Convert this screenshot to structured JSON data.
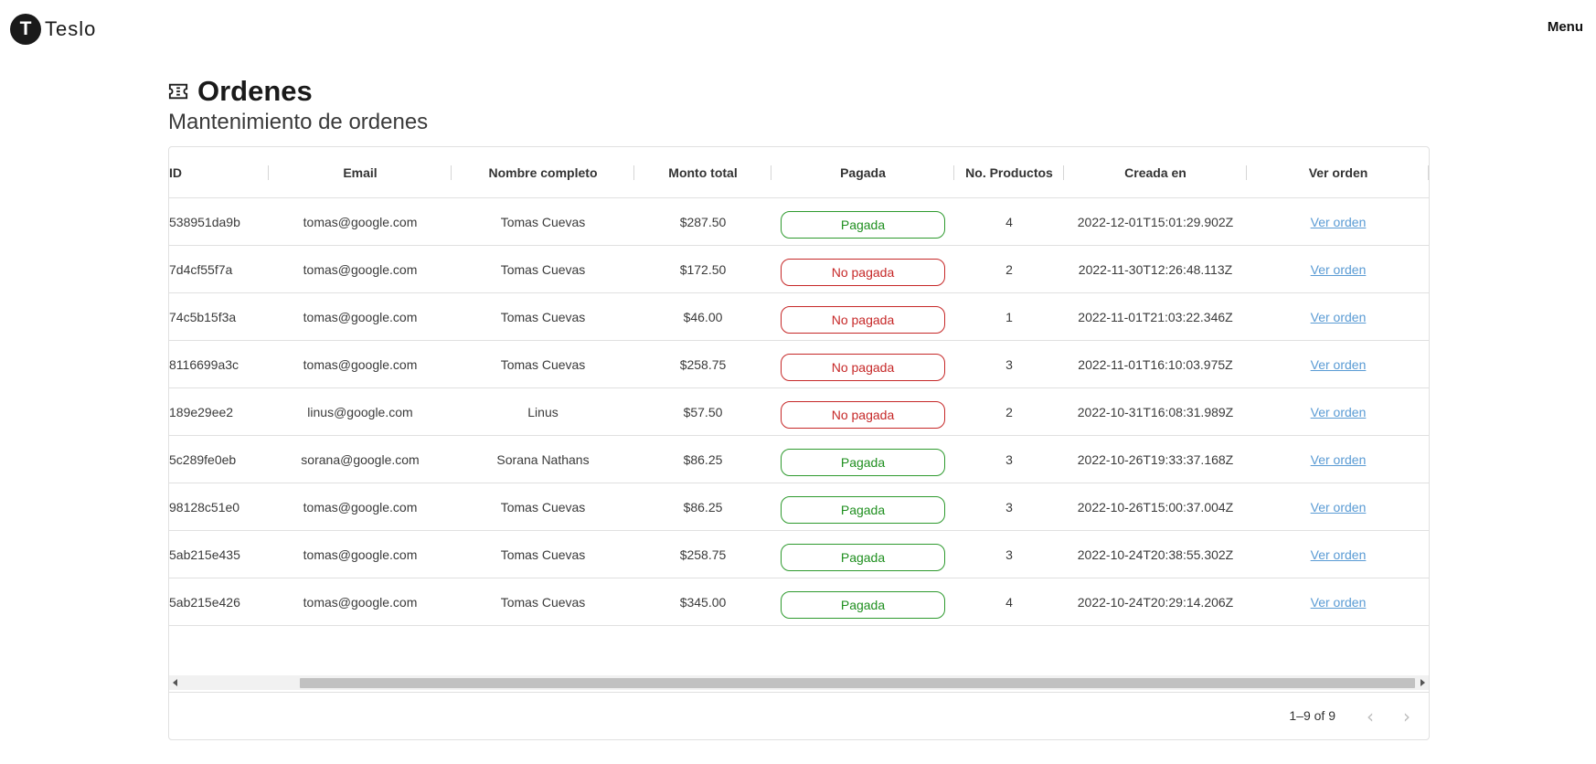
{
  "navbar": {
    "brand_letter": "T",
    "brand_name": "Teslo",
    "menu_label": "Menu"
  },
  "page": {
    "title": "Ordenes",
    "subtitle": "Mantenimiento de ordenes",
    "title_icon": "ticket-icon"
  },
  "columns": [
    "ID",
    "Email",
    "Nombre completo",
    "Monto total",
    "Pagada",
    "No. Productos",
    "Creada en",
    "Ver orden"
  ],
  "rows": [
    {
      "id": "538951da9b",
      "email": "tomas@google.com",
      "name": "Tomas Cuevas",
      "total": "$287.50",
      "status": "Pagada",
      "paid": true,
      "products": "4",
      "created": "2022-12-01T15:01:29.902Z",
      "link": "Ver orden"
    },
    {
      "id": "7d4cf55f7a",
      "email": "tomas@google.com",
      "name": "Tomas Cuevas",
      "total": "$172.50",
      "status": "No pagada",
      "paid": false,
      "products": "2",
      "created": "2022-11-30T12:26:48.113Z",
      "link": "Ver orden"
    },
    {
      "id": "74c5b15f3a",
      "email": "tomas@google.com",
      "name": "Tomas Cuevas",
      "total": "$46.00",
      "status": "No pagada",
      "paid": false,
      "products": "1",
      "created": "2022-11-01T21:03:22.346Z",
      "link": "Ver orden"
    },
    {
      "id": "8116699a3c",
      "email": "tomas@google.com",
      "name": "Tomas Cuevas",
      "total": "$258.75",
      "status": "No pagada",
      "paid": false,
      "products": "3",
      "created": "2022-11-01T16:10:03.975Z",
      "link": "Ver orden"
    },
    {
      "id": "189e29ee2",
      "email": "linus@google.com",
      "name": "Linus",
      "total": "$57.50",
      "status": "No pagada",
      "paid": false,
      "products": "2",
      "created": "2022-10-31T16:08:31.989Z",
      "link": "Ver orden"
    },
    {
      "id": "5c289fe0eb",
      "email": "sorana@google.com",
      "name": "Sorana Nathans",
      "total": "$86.25",
      "status": "Pagada",
      "paid": true,
      "products": "3",
      "created": "2022-10-26T19:33:37.168Z",
      "link": "Ver orden"
    },
    {
      "id": "98128c51e0",
      "email": "tomas@google.com",
      "name": "Tomas Cuevas",
      "total": "$86.25",
      "status": "Pagada",
      "paid": true,
      "products": "3",
      "created": "2022-10-26T15:00:37.004Z",
      "link": "Ver orden"
    },
    {
      "id": "5ab215e435",
      "email": "tomas@google.com",
      "name": "Tomas Cuevas",
      "total": "$258.75",
      "status": "Pagada",
      "paid": true,
      "products": "3",
      "created": "2022-10-24T20:38:55.302Z",
      "link": "Ver orden"
    },
    {
      "id": "5ab215e426",
      "email": "tomas@google.com",
      "name": "Tomas Cuevas",
      "total": "$345.00",
      "status": "Pagada",
      "paid": true,
      "products": "4",
      "created": "2022-10-24T20:29:14.206Z",
      "link": "Ver orden"
    }
  ],
  "pagination": {
    "label": "1–9 of 9",
    "prev_icon": "chevron-left-icon",
    "next_icon": "chevron-right-icon"
  },
  "colors": {
    "paid": "#1f8f1f",
    "unpaid": "#c62828",
    "link": "#5a9bd4"
  }
}
